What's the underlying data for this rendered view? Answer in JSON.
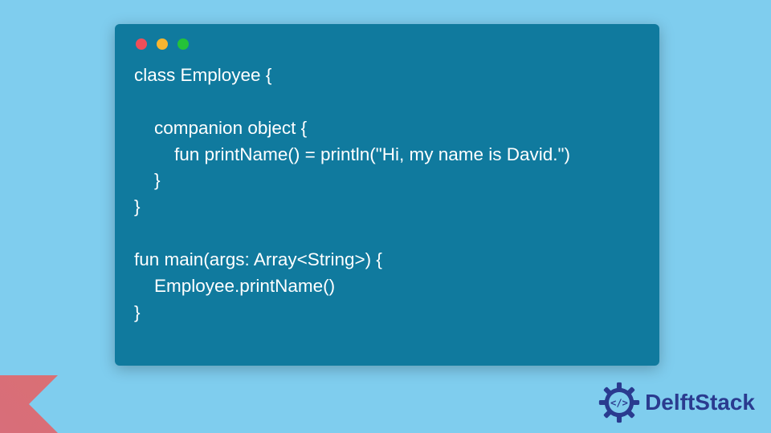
{
  "colors": {
    "page_bg": "#7fcdee",
    "window_bg": "#107a9e",
    "text": "#ffffff",
    "traffic_red": "#ef4e59",
    "traffic_yellow": "#f7b52f",
    "traffic_green": "#24c238",
    "brand_text": "#2a3b8f"
  },
  "code": {
    "lines": [
      "class Employee {",
      "",
      "    companion object {",
      "        fun printName() = println(\"Hi, my name is David.\")",
      "    }",
      "}",
      "",
      "fun main(args: Array<String>) {",
      "    Employee.printName()",
      "}"
    ]
  },
  "brand": {
    "name": "DelftStack",
    "icon": "gear-code-icon"
  },
  "corner_logo": "kotlin-logo"
}
